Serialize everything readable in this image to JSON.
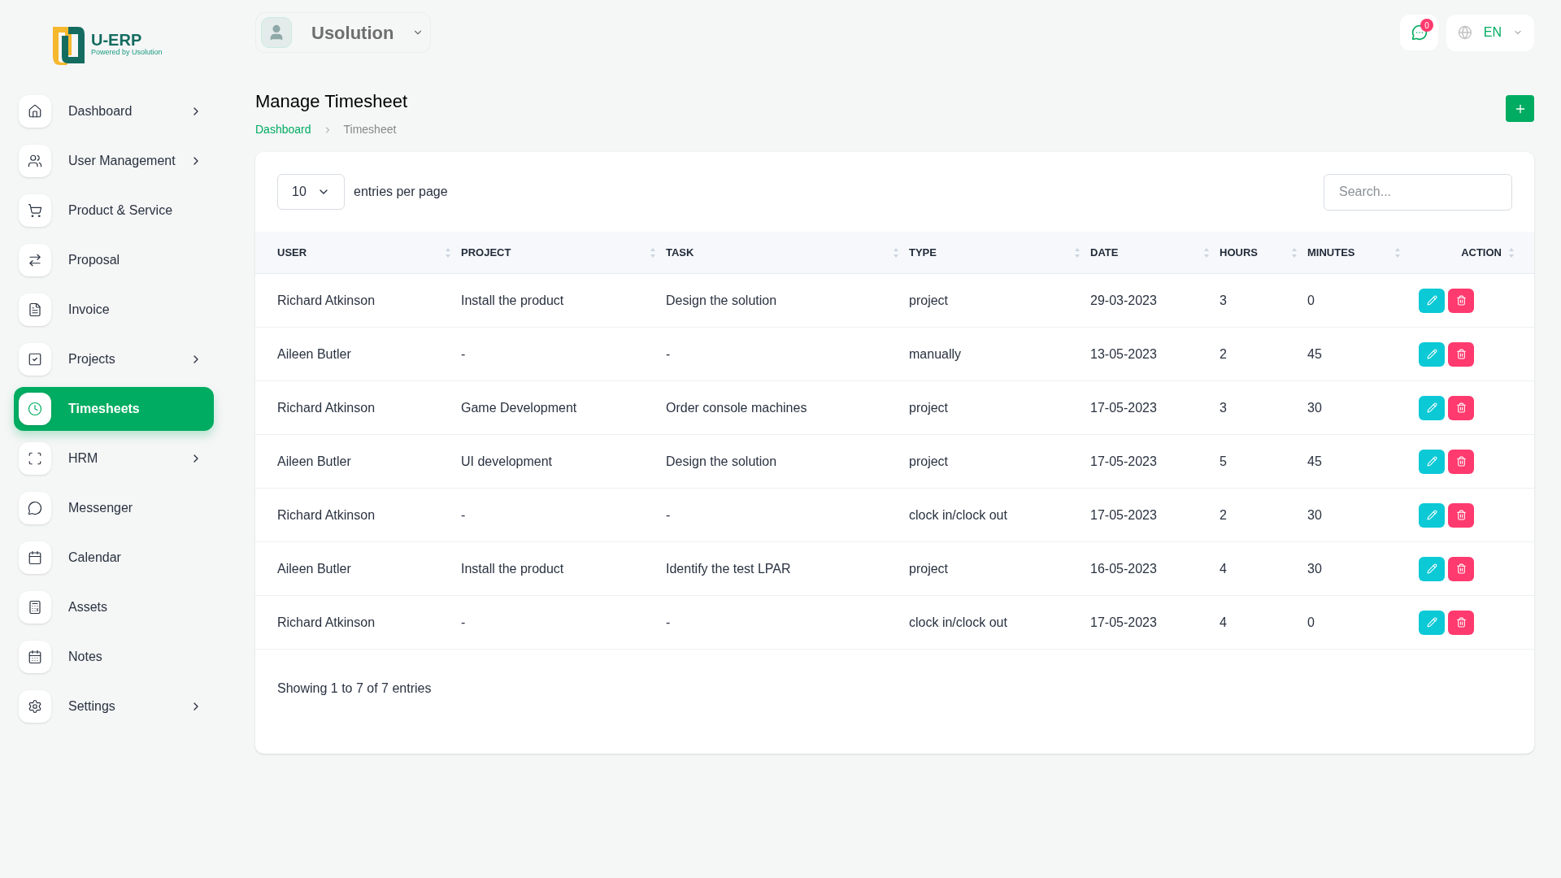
{
  "logo": {
    "name": "U-ERP",
    "tagline": "Powered by Usolution"
  },
  "sidebar": {
    "items": [
      {
        "label": "Dashboard",
        "selected": false,
        "has_submenu": true
      },
      {
        "label": "User Management",
        "selected": false,
        "has_submenu": true
      },
      {
        "label": "Product & Service",
        "selected": false,
        "has_submenu": false
      },
      {
        "label": "Proposal",
        "selected": false,
        "has_submenu": false
      },
      {
        "label": "Invoice",
        "selected": false,
        "has_submenu": false
      },
      {
        "label": "Projects",
        "selected": false,
        "has_submenu": true
      },
      {
        "label": "Timesheets",
        "selected": true,
        "has_submenu": false
      },
      {
        "label": "HRM",
        "selected": false,
        "has_submenu": true
      },
      {
        "label": "Messenger",
        "selected": false,
        "has_submenu": false
      },
      {
        "label": "Calendar",
        "selected": false,
        "has_submenu": false
      },
      {
        "label": "Assets",
        "selected": false,
        "has_submenu": false
      },
      {
        "label": "Notes",
        "selected": false,
        "has_submenu": false
      },
      {
        "label": "Settings",
        "selected": false,
        "has_submenu": true
      }
    ]
  },
  "header": {
    "workspace": "Usolution",
    "notification_count": "0",
    "language": "EN"
  },
  "page": {
    "title": "Manage Timesheet",
    "breadcrumb": [
      {
        "label": "Dashboard",
        "selected": false
      },
      {
        "label": "Timesheet",
        "selected": true
      }
    ]
  },
  "table_controls": {
    "page_size": "10",
    "page_size_label": "entries per page",
    "search_placeholder": "Search..."
  },
  "table": {
    "columns": [
      "USER",
      "PROJECT",
      "TASK",
      "TYPE",
      "DATE",
      "HOURS",
      "MINUTES",
      "ACTION"
    ],
    "rows": [
      [
        "Richard Atkinson",
        "Install the product",
        "Design the solution",
        "project",
        "29-03-2023",
        "3",
        "0"
      ],
      [
        "Aileen Butler",
        "-",
        "-",
        "manually",
        "13-05-2023",
        "2",
        "45"
      ],
      [
        "Richard Atkinson",
        "Game Development",
        "Order console machines",
        "project",
        "17-05-2023",
        "3",
        "30"
      ],
      [
        "Aileen Butler",
        "UI development",
        "Design the solution",
        "project",
        "17-05-2023",
        "5",
        "45"
      ],
      [
        "Richard Atkinson",
        "-",
        "-",
        "clock in/clock out",
        "17-05-2023",
        "2",
        "30"
      ],
      [
        "Aileen Butler",
        "Install the product",
        "Identify the test LPAR",
        "project",
        "16-05-2023",
        "4",
        "30"
      ],
      [
        "Richard Atkinson",
        "-",
        "-",
        "clock in/clock out",
        "17-05-2023",
        "4",
        "0"
      ]
    ]
  },
  "footer_text": "Showing 1 to 7 of 7 entries"
}
